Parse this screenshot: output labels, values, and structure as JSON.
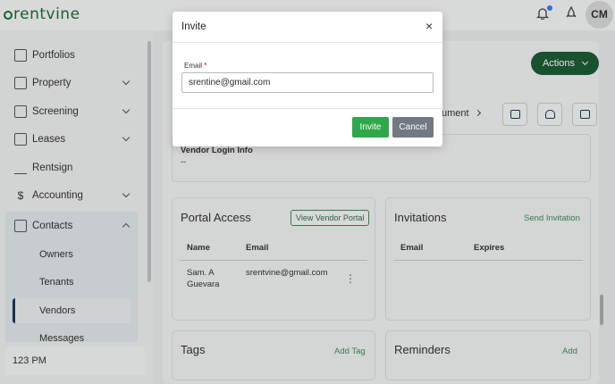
{
  "header": {
    "logo_text": "rentvine",
    "avatar_initials": "CM",
    "notification_dot_color": "#2f80ed"
  },
  "sidebar": {
    "items": [
      {
        "label": "Portfolios",
        "icon": "folder-icon"
      },
      {
        "label": "Property",
        "icon": "building-icon"
      },
      {
        "label": "Screening",
        "icon": "screening-icon"
      },
      {
        "label": "Leases",
        "icon": "document-icon"
      },
      {
        "label": "Rentsign",
        "icon": "signature-icon"
      },
      {
        "label": "Accounting",
        "icon": "dollar-icon"
      },
      {
        "label": "Contacts",
        "icon": "book-icon"
      }
    ],
    "contacts_sub": [
      "Owners",
      "Tenants",
      "Vendors",
      "Messages"
    ],
    "active_item": "Vendors",
    "footer_text": "123 PM"
  },
  "main": {
    "actions_label": "Actions",
    "document_link": "ument",
    "vendor_login": {
      "label": "Vendor Login Info",
      "value": "--"
    },
    "portal_access": {
      "title": "Portal Access",
      "button": "View Vendor Portal",
      "columns": [
        "Name",
        "Email"
      ],
      "rows": [
        {
          "name_line1": "Sam. A",
          "name_line2": "Guevara",
          "email": "srentvine@gmail.com"
        }
      ]
    },
    "invitations": {
      "title": "Invitations",
      "link": "Send Invitation",
      "columns": [
        "Email",
        "Expires"
      ]
    },
    "tags": {
      "title": "Tags",
      "link": "Add Tag"
    },
    "reminders": {
      "title": "Reminders",
      "link": "Add"
    }
  },
  "modal": {
    "title": "Invite",
    "close_glyph": "×",
    "email_label": "Email",
    "required_mark": "*",
    "email_value": "srentine@gmail.com",
    "invite_label": "Invite",
    "cancel_label": "Cancel"
  },
  "colors": {
    "brand_green": "#1e5b34",
    "invite_green": "#2ea84a",
    "cancel_gray": "#717a82",
    "link_green": "#3e8c5a"
  }
}
